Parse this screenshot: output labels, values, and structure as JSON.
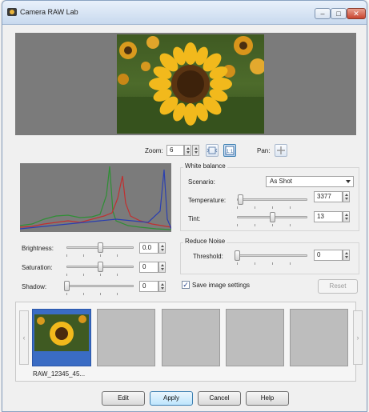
{
  "window": {
    "title": "Camera RAW Lab"
  },
  "view": {
    "zoom_label": "Zoom:",
    "zoom_value": "6",
    "pan_label": "Pan:"
  },
  "adjustments": {
    "brightness": {
      "label": "Brightness:",
      "value": "0.0",
      "level": 0.5
    },
    "saturation": {
      "label": "Saturation:",
      "value": "0",
      "level": 0.5
    },
    "shadow": {
      "label": "Shadow:",
      "value": "0",
      "level": 0.0
    }
  },
  "white_balance": {
    "group_title": "White balance",
    "scenario_label": "Scenario:",
    "scenario_value": "As Shot",
    "temperature_label": "Temperature:",
    "temperature_value": "3377",
    "temperature_level": 0.05,
    "tint_label": "Tint:",
    "tint_value": "13",
    "tint_level": 0.5
  },
  "reduce_noise": {
    "group_title": "Reduce Noise",
    "threshold_label": "Threshold:",
    "threshold_value": "0",
    "threshold_level": 0.0
  },
  "save_settings": {
    "label": "Save image settings",
    "checked": true
  },
  "reset_label": "Reset",
  "thumbnails": {
    "first_caption": "RAW_12345_45..."
  },
  "buttons": {
    "edit": "Edit",
    "apply": "Apply",
    "cancel": "Cancel",
    "help": "Help"
  },
  "colors": {
    "accent": "#3c7fb1",
    "histogram_bg": "#7b7b7b"
  }
}
